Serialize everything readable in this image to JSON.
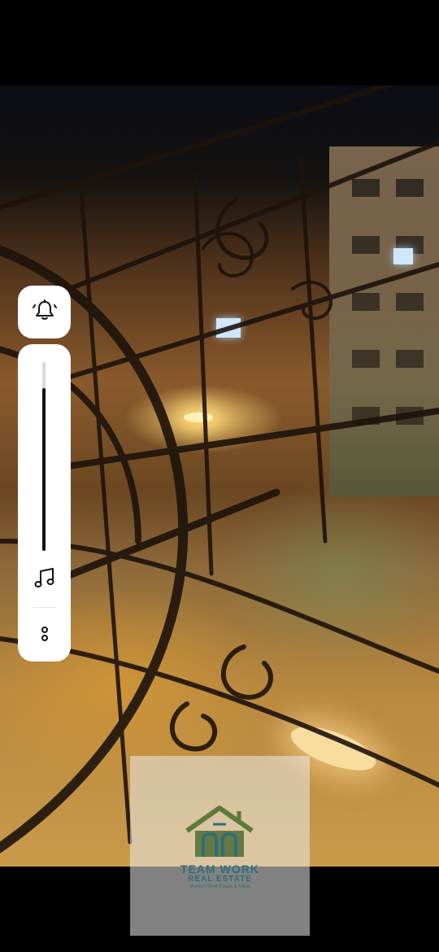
{
  "controls": {
    "ringer_icon": "bell-icon",
    "volume_level": 0.86,
    "music_icon": "music-note-icon",
    "more_icon": "more-options-icon"
  },
  "watermark": {
    "title": "TEAM WORK",
    "subtitle": "REAL ESTATE",
    "tagline": "Modern Real Estate & Villas",
    "brand_color": "#2d6f7a",
    "roof_color": "#5d7a3a"
  }
}
